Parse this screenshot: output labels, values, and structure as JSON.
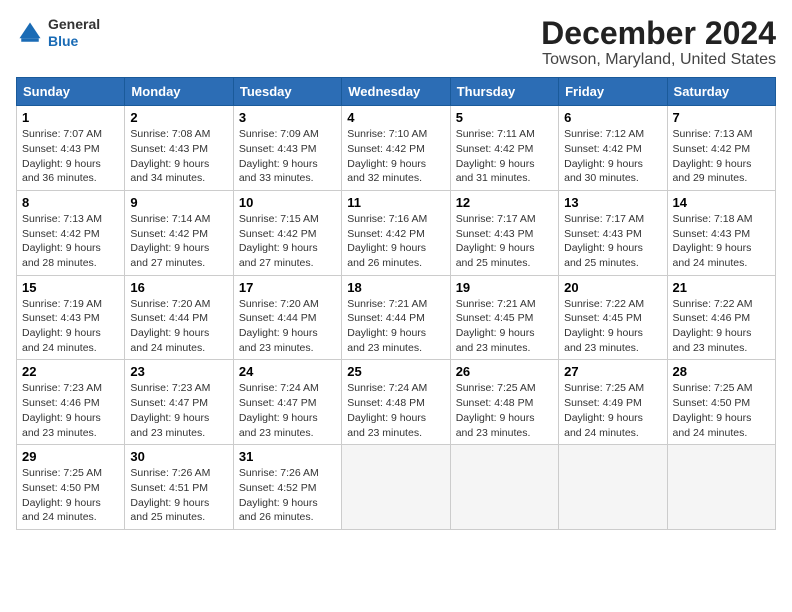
{
  "logo": {
    "general": "General",
    "blue": "Blue"
  },
  "title": "December 2024",
  "subtitle": "Towson, Maryland, United States",
  "days_header": [
    "Sunday",
    "Monday",
    "Tuesday",
    "Wednesday",
    "Thursday",
    "Friday",
    "Saturday"
  ],
  "weeks": [
    [
      {
        "day": "1",
        "sunrise": "7:07 AM",
        "sunset": "4:43 PM",
        "daylight": "9 hours and 36 minutes."
      },
      {
        "day": "2",
        "sunrise": "7:08 AM",
        "sunset": "4:43 PM",
        "daylight": "9 hours and 34 minutes."
      },
      {
        "day": "3",
        "sunrise": "7:09 AM",
        "sunset": "4:43 PM",
        "daylight": "9 hours and 33 minutes."
      },
      {
        "day": "4",
        "sunrise": "7:10 AM",
        "sunset": "4:42 PM",
        "daylight": "9 hours and 32 minutes."
      },
      {
        "day": "5",
        "sunrise": "7:11 AM",
        "sunset": "4:42 PM",
        "daylight": "9 hours and 31 minutes."
      },
      {
        "day": "6",
        "sunrise": "7:12 AM",
        "sunset": "4:42 PM",
        "daylight": "9 hours and 30 minutes."
      },
      {
        "day": "7",
        "sunrise": "7:13 AM",
        "sunset": "4:42 PM",
        "daylight": "9 hours and 29 minutes."
      }
    ],
    [
      {
        "day": "8",
        "sunrise": "7:13 AM",
        "sunset": "4:42 PM",
        "daylight": "9 hours and 28 minutes."
      },
      {
        "day": "9",
        "sunrise": "7:14 AM",
        "sunset": "4:42 PM",
        "daylight": "9 hours and 27 minutes."
      },
      {
        "day": "10",
        "sunrise": "7:15 AM",
        "sunset": "4:42 PM",
        "daylight": "9 hours and 27 minutes."
      },
      {
        "day": "11",
        "sunrise": "7:16 AM",
        "sunset": "4:42 PM",
        "daylight": "9 hours and 26 minutes."
      },
      {
        "day": "12",
        "sunrise": "7:17 AM",
        "sunset": "4:43 PM",
        "daylight": "9 hours and 25 minutes."
      },
      {
        "day": "13",
        "sunrise": "7:17 AM",
        "sunset": "4:43 PM",
        "daylight": "9 hours and 25 minutes."
      },
      {
        "day": "14",
        "sunrise": "7:18 AM",
        "sunset": "4:43 PM",
        "daylight": "9 hours and 24 minutes."
      }
    ],
    [
      {
        "day": "15",
        "sunrise": "7:19 AM",
        "sunset": "4:43 PM",
        "daylight": "9 hours and 24 minutes."
      },
      {
        "day": "16",
        "sunrise": "7:20 AM",
        "sunset": "4:44 PM",
        "daylight": "9 hours and 24 minutes."
      },
      {
        "day": "17",
        "sunrise": "7:20 AM",
        "sunset": "4:44 PM",
        "daylight": "9 hours and 23 minutes."
      },
      {
        "day": "18",
        "sunrise": "7:21 AM",
        "sunset": "4:44 PM",
        "daylight": "9 hours and 23 minutes."
      },
      {
        "day": "19",
        "sunrise": "7:21 AM",
        "sunset": "4:45 PM",
        "daylight": "9 hours and 23 minutes."
      },
      {
        "day": "20",
        "sunrise": "7:22 AM",
        "sunset": "4:45 PM",
        "daylight": "9 hours and 23 minutes."
      },
      {
        "day": "21",
        "sunrise": "7:22 AM",
        "sunset": "4:46 PM",
        "daylight": "9 hours and 23 minutes."
      }
    ],
    [
      {
        "day": "22",
        "sunrise": "7:23 AM",
        "sunset": "4:46 PM",
        "daylight": "9 hours and 23 minutes."
      },
      {
        "day": "23",
        "sunrise": "7:23 AM",
        "sunset": "4:47 PM",
        "daylight": "9 hours and 23 minutes."
      },
      {
        "day": "24",
        "sunrise": "7:24 AM",
        "sunset": "4:47 PM",
        "daylight": "9 hours and 23 minutes."
      },
      {
        "day": "25",
        "sunrise": "7:24 AM",
        "sunset": "4:48 PM",
        "daylight": "9 hours and 23 minutes."
      },
      {
        "day": "26",
        "sunrise": "7:25 AM",
        "sunset": "4:48 PM",
        "daylight": "9 hours and 23 minutes."
      },
      {
        "day": "27",
        "sunrise": "7:25 AM",
        "sunset": "4:49 PM",
        "daylight": "9 hours and 24 minutes."
      },
      {
        "day": "28",
        "sunrise": "7:25 AM",
        "sunset": "4:50 PM",
        "daylight": "9 hours and 24 minutes."
      }
    ],
    [
      {
        "day": "29",
        "sunrise": "7:25 AM",
        "sunset": "4:50 PM",
        "daylight": "9 hours and 24 minutes."
      },
      {
        "day": "30",
        "sunrise": "7:26 AM",
        "sunset": "4:51 PM",
        "daylight": "9 hours and 25 minutes."
      },
      {
        "day": "31",
        "sunrise": "7:26 AM",
        "sunset": "4:52 PM",
        "daylight": "9 hours and 26 minutes."
      },
      null,
      null,
      null,
      null
    ]
  ]
}
